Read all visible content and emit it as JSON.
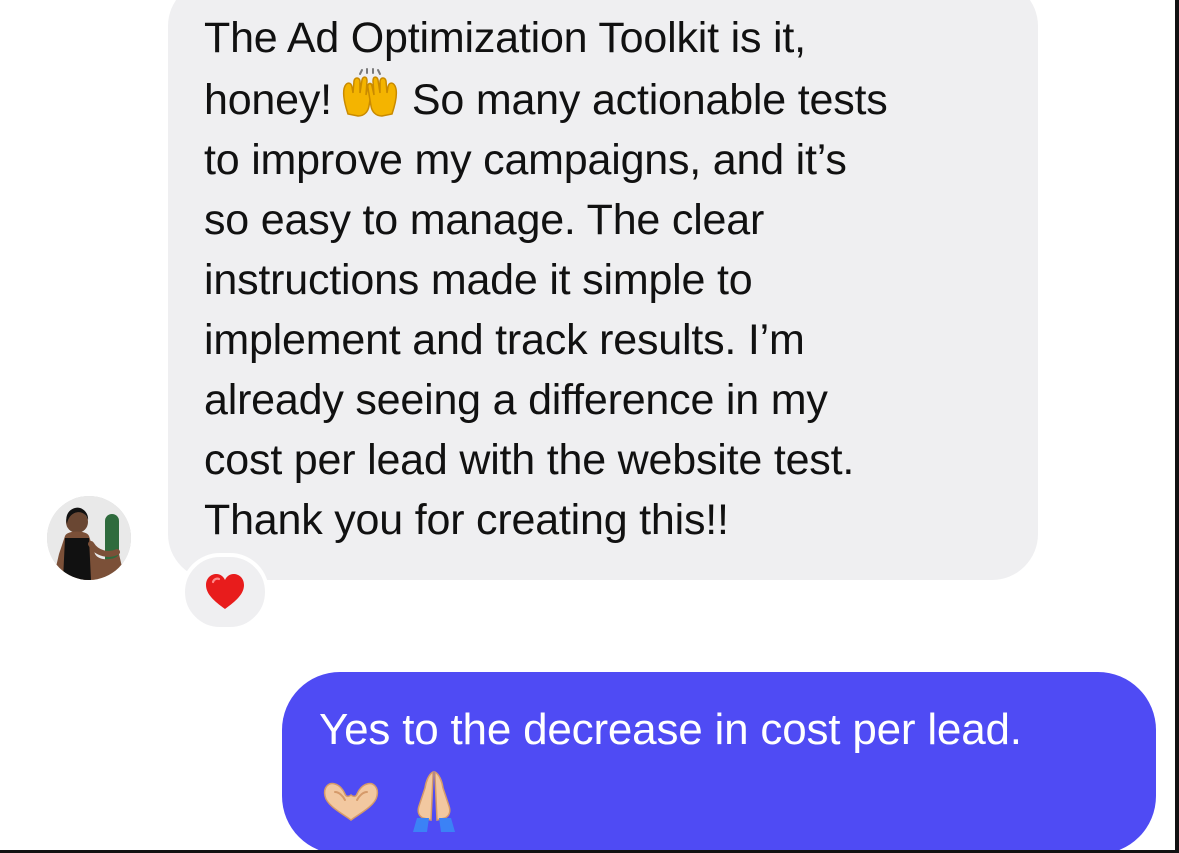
{
  "conversation": {
    "incoming": {
      "text_part1": "The Ad Optimization Toolkit is it,\nhoney!",
      "text_part2": "So many actionable tests\nto improve my campaigns, and it’s\nso easy to manage. The clear\ninstructions made it simple to\nimplement and track results. I’m\nalready seeing a difference in my\ncost per lead with the website test.\nThank you for creating this!!",
      "inline_emoji": "raising-hands-icon",
      "reaction_icon": "red-heart-icon",
      "bubble_color": "#efeff1"
    },
    "outgoing": {
      "text": "Yes to the decrease in cost per lead.",
      "emojis": [
        "heart-hands-icon",
        "folded-hands-icon"
      ],
      "bubble_color": "#4f4bf4"
    }
  }
}
